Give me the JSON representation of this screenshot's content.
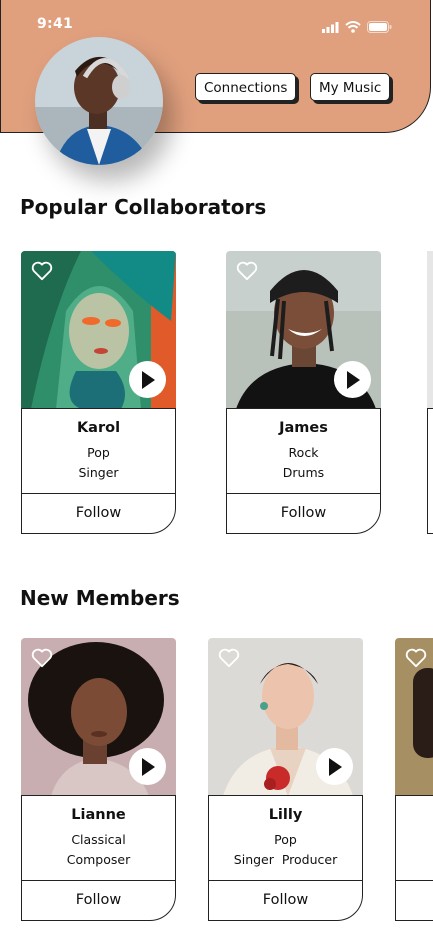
{
  "status_bar": {
    "time": "9:41"
  },
  "header": {
    "connections_label": "Connections",
    "my_music_label": "My Music"
  },
  "popular": {
    "title": "Popular Collaborators",
    "cards": [
      {
        "name": "Karol",
        "genre": "Pop",
        "role": "Singer",
        "follow": "Follow"
      },
      {
        "name": "James",
        "genre": "Rock",
        "role": "Drums",
        "follow": "Follow"
      }
    ]
  },
  "new_members": {
    "title": "New Members",
    "cards": [
      {
        "name": "Lianne",
        "genre": "Classical",
        "role": "Composer",
        "follow": "Follow"
      },
      {
        "name": "Lilly",
        "genre": "Pop",
        "role": "Singer  Producer",
        "follow": "Follow"
      }
    ]
  },
  "colors": {
    "header_bg": "#e0a07e",
    "text": "#111111",
    "border": "#222222"
  },
  "icons": [
    "signal-icon",
    "wifi-icon",
    "battery-icon",
    "heart-icon",
    "play-icon"
  ]
}
